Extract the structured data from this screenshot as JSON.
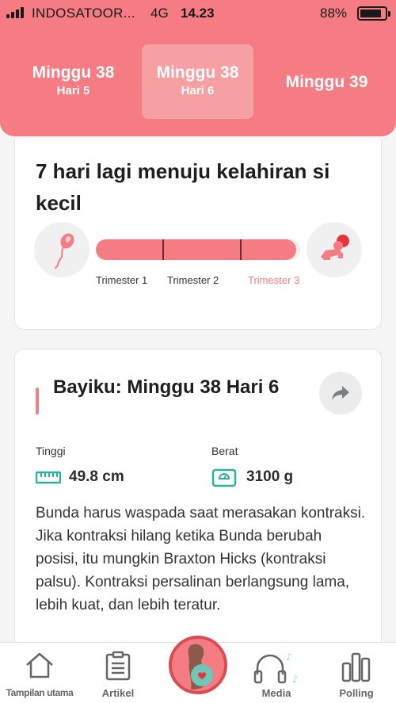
{
  "status_bar": {
    "carrier": "INDOSATOOR...",
    "network": "4G",
    "time": "14.23",
    "battery": "88%",
    "battery_level": 0.88
  },
  "week_tabs": [
    {
      "week": "Minggu 38",
      "day": "Hari 5"
    },
    {
      "week": "Minggu 38",
      "day": "Hari 6"
    },
    {
      "week": "Minggu 39",
      "day": ""
    }
  ],
  "countdown": {
    "text": "7 hari lagi menuju kelahiran si kecil",
    "progress": 0.98,
    "trimesters": [
      "Trimester 1",
      "Trimester 2",
      "Trimester 3"
    ],
    "active_trimester": 3
  },
  "baby": {
    "title": "Bayiku: Minggu 38 Hari 6",
    "height_label": "Tinggi",
    "height_value": "49.8 cm",
    "weight_label": "Berat",
    "weight_value": "3100 g",
    "description": "Bunda harus waspada saat merasakan kontraksi. Jika kontraksi hilang ketika Bunda berubah posisi, itu mungkin Braxton Hicks (kontraksi palsu). Kontraksi persalinan berlangsung lama, lebih kuat, dan lebih teratur."
  },
  "bottom_nav": [
    {
      "label": "Tampilan utama",
      "icon": "home-icon"
    },
    {
      "label": "Artikel",
      "icon": "article-icon"
    },
    {
      "label": "",
      "icon": "pregnancy-icon"
    },
    {
      "label": "Media",
      "icon": "headphones-icon"
    },
    {
      "label": "Polling",
      "icon": "poll-icon"
    }
  ],
  "colors": {
    "accent": "#f47c82",
    "accent_dark": "#d94c56",
    "bar_divider": "#6a2b2e"
  }
}
